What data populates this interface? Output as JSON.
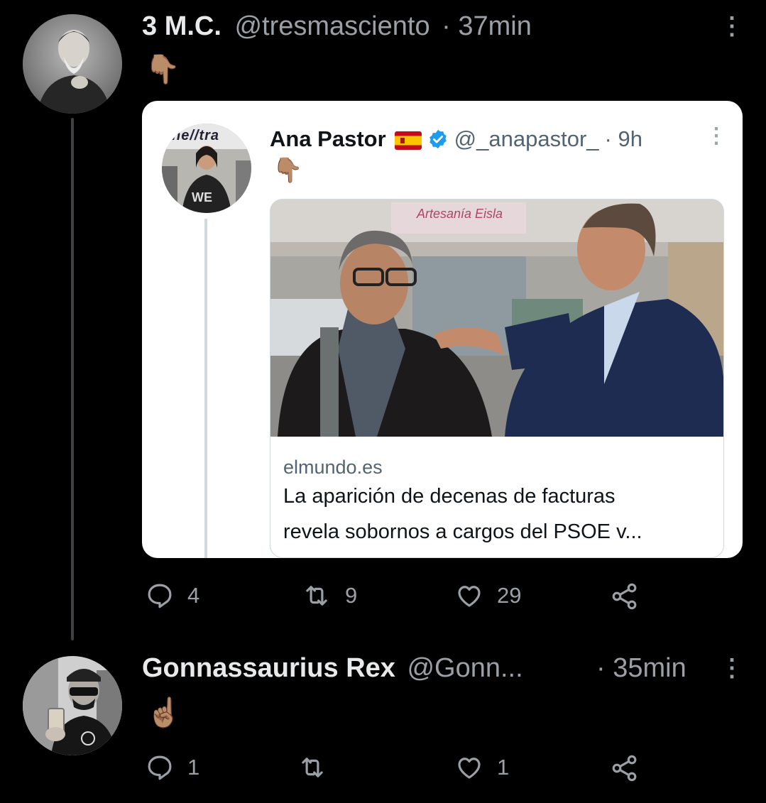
{
  "tweets": [
    {
      "name": "3 M.C.",
      "handle": "@tresmasciento",
      "time": "· 37min",
      "emoji": "👇🏽",
      "more": "⋮",
      "actions": {
        "reply": "4",
        "retweet": "9",
        "like": "29"
      }
    },
    {
      "name": "Gonnassaurius Rex",
      "handle": "@Gonn...",
      "time": "· 35min",
      "emoji": "☝🏽",
      "more": "⋮",
      "actions": {
        "reply": "1",
        "retweet": "",
        "like": "1"
      }
    }
  ],
  "quote": {
    "name": "Ana Pastor",
    "handle": "@_anapastor_",
    "time": "· 9h",
    "emoji": "👇🏽",
    "more": "⋮",
    "avatar_sign": "ne//tra",
    "avatar_shirt": "WE",
    "verified_icon": "verified-badge-icon",
    "flag_icon": "spain-flag-icon",
    "link_card": {
      "sign_text": "Artesanía Eisla",
      "domain": "elmundo.es",
      "title_line1": "La aparición de decenas de facturas",
      "title_line2": "revela sobornos a cargos del PSOE v..."
    }
  },
  "colors": {
    "background": "#000000",
    "muted": "#9aa0a6",
    "verified": "#1d9bf0"
  }
}
